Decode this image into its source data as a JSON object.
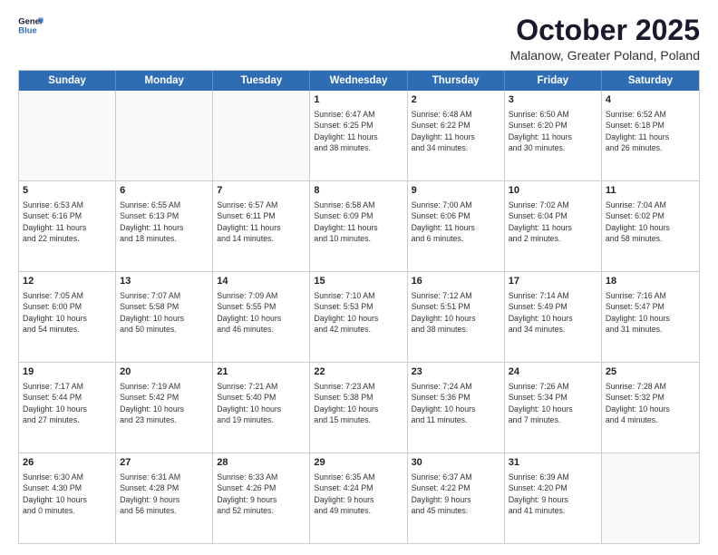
{
  "logo": {
    "line1": "General",
    "line2": "Blue"
  },
  "title": "October 2025",
  "location": "Malanow, Greater Poland, Poland",
  "weekdays": [
    "Sunday",
    "Monday",
    "Tuesday",
    "Wednesday",
    "Thursday",
    "Friday",
    "Saturday"
  ],
  "rows": [
    [
      {
        "day": "",
        "info": ""
      },
      {
        "day": "",
        "info": ""
      },
      {
        "day": "",
        "info": ""
      },
      {
        "day": "1",
        "info": "Sunrise: 6:47 AM\nSunset: 6:25 PM\nDaylight: 11 hours\nand 38 minutes."
      },
      {
        "day": "2",
        "info": "Sunrise: 6:48 AM\nSunset: 6:22 PM\nDaylight: 11 hours\nand 34 minutes."
      },
      {
        "day": "3",
        "info": "Sunrise: 6:50 AM\nSunset: 6:20 PM\nDaylight: 11 hours\nand 30 minutes."
      },
      {
        "day": "4",
        "info": "Sunrise: 6:52 AM\nSunset: 6:18 PM\nDaylight: 11 hours\nand 26 minutes."
      }
    ],
    [
      {
        "day": "5",
        "info": "Sunrise: 6:53 AM\nSunset: 6:16 PM\nDaylight: 11 hours\nand 22 minutes."
      },
      {
        "day": "6",
        "info": "Sunrise: 6:55 AM\nSunset: 6:13 PM\nDaylight: 11 hours\nand 18 minutes."
      },
      {
        "day": "7",
        "info": "Sunrise: 6:57 AM\nSunset: 6:11 PM\nDaylight: 11 hours\nand 14 minutes."
      },
      {
        "day": "8",
        "info": "Sunrise: 6:58 AM\nSunset: 6:09 PM\nDaylight: 11 hours\nand 10 minutes."
      },
      {
        "day": "9",
        "info": "Sunrise: 7:00 AM\nSunset: 6:06 PM\nDaylight: 11 hours\nand 6 minutes."
      },
      {
        "day": "10",
        "info": "Sunrise: 7:02 AM\nSunset: 6:04 PM\nDaylight: 11 hours\nand 2 minutes."
      },
      {
        "day": "11",
        "info": "Sunrise: 7:04 AM\nSunset: 6:02 PM\nDaylight: 10 hours\nand 58 minutes."
      }
    ],
    [
      {
        "day": "12",
        "info": "Sunrise: 7:05 AM\nSunset: 6:00 PM\nDaylight: 10 hours\nand 54 minutes."
      },
      {
        "day": "13",
        "info": "Sunrise: 7:07 AM\nSunset: 5:58 PM\nDaylight: 10 hours\nand 50 minutes."
      },
      {
        "day": "14",
        "info": "Sunrise: 7:09 AM\nSunset: 5:55 PM\nDaylight: 10 hours\nand 46 minutes."
      },
      {
        "day": "15",
        "info": "Sunrise: 7:10 AM\nSunset: 5:53 PM\nDaylight: 10 hours\nand 42 minutes."
      },
      {
        "day": "16",
        "info": "Sunrise: 7:12 AM\nSunset: 5:51 PM\nDaylight: 10 hours\nand 38 minutes."
      },
      {
        "day": "17",
        "info": "Sunrise: 7:14 AM\nSunset: 5:49 PM\nDaylight: 10 hours\nand 34 minutes."
      },
      {
        "day": "18",
        "info": "Sunrise: 7:16 AM\nSunset: 5:47 PM\nDaylight: 10 hours\nand 31 minutes."
      }
    ],
    [
      {
        "day": "19",
        "info": "Sunrise: 7:17 AM\nSunset: 5:44 PM\nDaylight: 10 hours\nand 27 minutes."
      },
      {
        "day": "20",
        "info": "Sunrise: 7:19 AM\nSunset: 5:42 PM\nDaylight: 10 hours\nand 23 minutes."
      },
      {
        "day": "21",
        "info": "Sunrise: 7:21 AM\nSunset: 5:40 PM\nDaylight: 10 hours\nand 19 minutes."
      },
      {
        "day": "22",
        "info": "Sunrise: 7:23 AM\nSunset: 5:38 PM\nDaylight: 10 hours\nand 15 minutes."
      },
      {
        "day": "23",
        "info": "Sunrise: 7:24 AM\nSunset: 5:36 PM\nDaylight: 10 hours\nand 11 minutes."
      },
      {
        "day": "24",
        "info": "Sunrise: 7:26 AM\nSunset: 5:34 PM\nDaylight: 10 hours\nand 7 minutes."
      },
      {
        "day": "25",
        "info": "Sunrise: 7:28 AM\nSunset: 5:32 PM\nDaylight: 10 hours\nand 4 minutes."
      }
    ],
    [
      {
        "day": "26",
        "info": "Sunrise: 6:30 AM\nSunset: 4:30 PM\nDaylight: 10 hours\nand 0 minutes."
      },
      {
        "day": "27",
        "info": "Sunrise: 6:31 AM\nSunset: 4:28 PM\nDaylight: 9 hours\nand 56 minutes."
      },
      {
        "day": "28",
        "info": "Sunrise: 6:33 AM\nSunset: 4:26 PM\nDaylight: 9 hours\nand 52 minutes."
      },
      {
        "day": "29",
        "info": "Sunrise: 6:35 AM\nSunset: 4:24 PM\nDaylight: 9 hours\nand 49 minutes."
      },
      {
        "day": "30",
        "info": "Sunrise: 6:37 AM\nSunset: 4:22 PM\nDaylight: 9 hours\nand 45 minutes."
      },
      {
        "day": "31",
        "info": "Sunrise: 6:39 AM\nSunset: 4:20 PM\nDaylight: 9 hours\nand 41 minutes."
      },
      {
        "day": "",
        "info": ""
      }
    ]
  ]
}
